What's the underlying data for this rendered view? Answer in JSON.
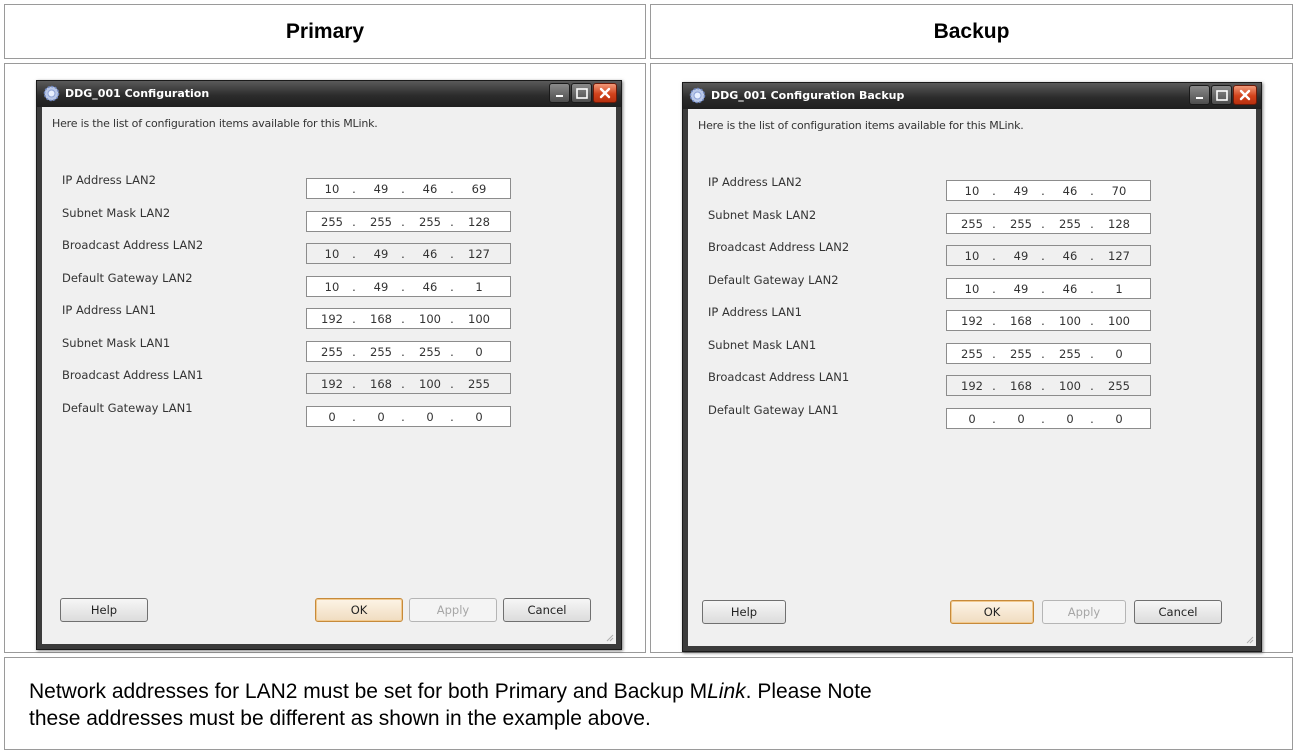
{
  "headers": {
    "left": "Primary",
    "right": "Backup"
  },
  "note": {
    "prefix": "Network addresses for LAN2 must be set for both Primary and Backup M",
    "italic": "Link",
    "suffix": ".  Please Note",
    "line2": "these addresses must be different as shown in the example above."
  },
  "labels": [
    "IP Address LAN2",
    "Subnet Mask LAN2",
    "Broadcast Address LAN2",
    "Default Gateway LAN2",
    "IP Address LAN1",
    "Subnet Mask LAN1",
    "Broadcast Address LAN1",
    "Default Gateway LAN1"
  ],
  "dialogs": [
    {
      "title": "DDG_001 Configuration",
      "intro": "Here is the list of configuration items available for this MLink.",
      "fields": [
        {
          "octets": [
            "10",
            "49",
            "46",
            "69"
          ],
          "readonly": false
        },
        {
          "octets": [
            "255",
            "255",
            "255",
            "128"
          ],
          "readonly": false
        },
        {
          "octets": [
            "10",
            "49",
            "46",
            "127"
          ],
          "readonly": true
        },
        {
          "octets": [
            "10",
            "49",
            "46",
            "1"
          ],
          "readonly": false
        },
        {
          "octets": [
            "192",
            "168",
            "100",
            "100"
          ],
          "readonly": false
        },
        {
          "octets": [
            "255",
            "255",
            "255",
            "0"
          ],
          "readonly": false
        },
        {
          "octets": [
            "192",
            "168",
            "100",
            "255"
          ],
          "readonly": true
        },
        {
          "octets": [
            "0",
            "0",
            "0",
            "0"
          ],
          "readonly": false
        }
      ],
      "buttons": {
        "help": "Help",
        "ok": "OK",
        "apply": "Apply",
        "cancel": "Cancel"
      }
    },
    {
      "title": "DDG_001 Configuration Backup",
      "intro": "Here is the list of configuration items available for this MLink.",
      "fields": [
        {
          "octets": [
            "10",
            "49",
            "46",
            "70"
          ],
          "readonly": false
        },
        {
          "octets": [
            "255",
            "255",
            "255",
            "128"
          ],
          "readonly": false
        },
        {
          "octets": [
            "10",
            "49",
            "46",
            "127"
          ],
          "readonly": true
        },
        {
          "octets": [
            "10",
            "49",
            "46",
            "1"
          ],
          "readonly": false
        },
        {
          "octets": [
            "192",
            "168",
            "100",
            "100"
          ],
          "readonly": false
        },
        {
          "octets": [
            "255",
            "255",
            "255",
            "0"
          ],
          "readonly": false
        },
        {
          "octets": [
            "192",
            "168",
            "100",
            "255"
          ],
          "readonly": true
        },
        {
          "octets": [
            "0",
            "0",
            "0",
            "0"
          ],
          "readonly": false
        }
      ],
      "buttons": {
        "help": "Help",
        "ok": "OK",
        "apply": "Apply",
        "cancel": "Cancel"
      }
    }
  ],
  "colors": {
    "titlebar": "#2c2c2c",
    "close_button": "#d2431c",
    "client_bg": "#f0f0f0",
    "default_button_border": "#c68a3b"
  }
}
